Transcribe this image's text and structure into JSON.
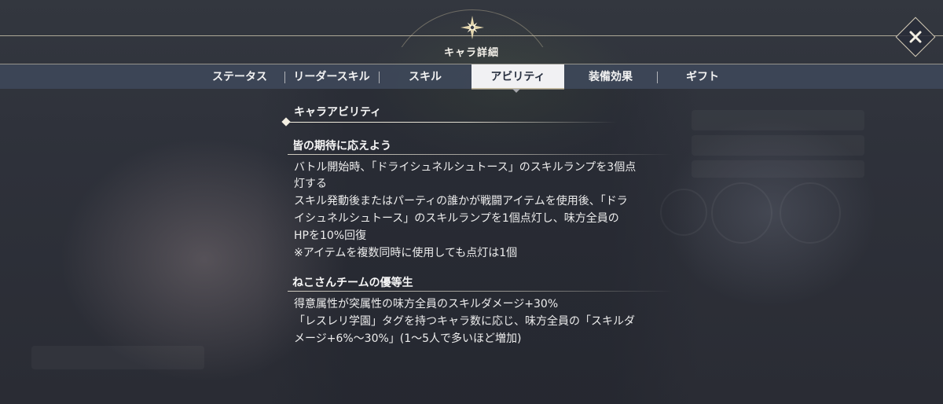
{
  "header": {
    "title": "キャラ詳細"
  },
  "tabs": [
    {
      "label": "ステータス",
      "active": false
    },
    {
      "label": "リーダースキル",
      "active": false
    },
    {
      "label": "スキル",
      "active": false
    },
    {
      "label": "アビリティ",
      "active": true
    },
    {
      "label": "装備効果",
      "active": false
    },
    {
      "label": "ギフト",
      "active": false
    }
  ],
  "section": {
    "title": "キャラアビリティ"
  },
  "abilities": [
    {
      "name": "皆の期待に応えよう",
      "lines": [
        "バトル開始時、「ドライシュネルシュトース」のスキルランプを3個点",
        "灯する",
        "スキル発動後またはパーティの誰かが戦闘アイテムを使用後、「ドラ",
        "イシュネルシュトース」のスキルランプを1個点灯し、味方全員の",
        "HPを10%回復",
        "※アイテムを複数同時に使用しても点灯は1個"
      ]
    },
    {
      "name": "ねこさんチームの優等生",
      "lines": [
        "得意属性が突属性の味方全員のスキルダメージ+30%",
        "「レスレリ学園」タグを持つキャラ数に応じ、味方全員の「スキルダ",
        "メージ+6%～30%」(1～5人で多いほど増加)"
      ]
    }
  ],
  "icons": {
    "emblem": "compass-star-icon",
    "close": "close-icon"
  },
  "colors": {
    "accent": "#d8cba6",
    "tabbar": "#3e485a",
    "active_tab": "#f1f1f3"
  }
}
